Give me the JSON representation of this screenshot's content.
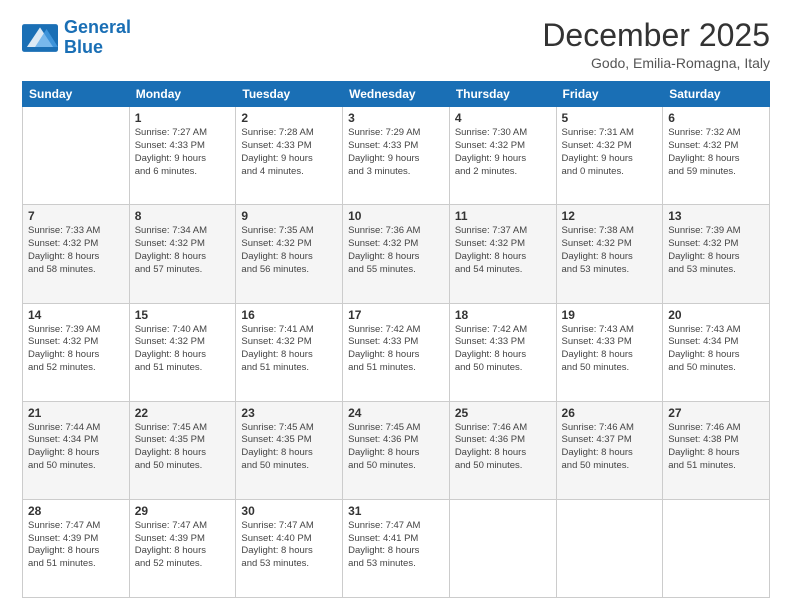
{
  "logo": {
    "line1": "General",
    "line2": "Blue"
  },
  "header": {
    "month": "December 2025",
    "location": "Godo, Emilia-Romagna, Italy"
  },
  "weekdays": [
    "Sunday",
    "Monday",
    "Tuesday",
    "Wednesday",
    "Thursday",
    "Friday",
    "Saturday"
  ],
  "weeks": [
    [
      {
        "day": "",
        "info": ""
      },
      {
        "day": "1",
        "info": "Sunrise: 7:27 AM\nSunset: 4:33 PM\nDaylight: 9 hours\nand 6 minutes."
      },
      {
        "day": "2",
        "info": "Sunrise: 7:28 AM\nSunset: 4:33 PM\nDaylight: 9 hours\nand 4 minutes."
      },
      {
        "day": "3",
        "info": "Sunrise: 7:29 AM\nSunset: 4:33 PM\nDaylight: 9 hours\nand 3 minutes."
      },
      {
        "day": "4",
        "info": "Sunrise: 7:30 AM\nSunset: 4:32 PM\nDaylight: 9 hours\nand 2 minutes."
      },
      {
        "day": "5",
        "info": "Sunrise: 7:31 AM\nSunset: 4:32 PM\nDaylight: 9 hours\nand 0 minutes."
      },
      {
        "day": "6",
        "info": "Sunrise: 7:32 AM\nSunset: 4:32 PM\nDaylight: 8 hours\nand 59 minutes."
      }
    ],
    [
      {
        "day": "7",
        "info": "Sunrise: 7:33 AM\nSunset: 4:32 PM\nDaylight: 8 hours\nand 58 minutes."
      },
      {
        "day": "8",
        "info": "Sunrise: 7:34 AM\nSunset: 4:32 PM\nDaylight: 8 hours\nand 57 minutes."
      },
      {
        "day": "9",
        "info": "Sunrise: 7:35 AM\nSunset: 4:32 PM\nDaylight: 8 hours\nand 56 minutes."
      },
      {
        "day": "10",
        "info": "Sunrise: 7:36 AM\nSunset: 4:32 PM\nDaylight: 8 hours\nand 55 minutes."
      },
      {
        "day": "11",
        "info": "Sunrise: 7:37 AM\nSunset: 4:32 PM\nDaylight: 8 hours\nand 54 minutes."
      },
      {
        "day": "12",
        "info": "Sunrise: 7:38 AM\nSunset: 4:32 PM\nDaylight: 8 hours\nand 53 minutes."
      },
      {
        "day": "13",
        "info": "Sunrise: 7:39 AM\nSunset: 4:32 PM\nDaylight: 8 hours\nand 53 minutes."
      }
    ],
    [
      {
        "day": "14",
        "info": "Sunrise: 7:39 AM\nSunset: 4:32 PM\nDaylight: 8 hours\nand 52 minutes."
      },
      {
        "day": "15",
        "info": "Sunrise: 7:40 AM\nSunset: 4:32 PM\nDaylight: 8 hours\nand 51 minutes."
      },
      {
        "day": "16",
        "info": "Sunrise: 7:41 AM\nSunset: 4:32 PM\nDaylight: 8 hours\nand 51 minutes."
      },
      {
        "day": "17",
        "info": "Sunrise: 7:42 AM\nSunset: 4:33 PM\nDaylight: 8 hours\nand 51 minutes."
      },
      {
        "day": "18",
        "info": "Sunrise: 7:42 AM\nSunset: 4:33 PM\nDaylight: 8 hours\nand 50 minutes."
      },
      {
        "day": "19",
        "info": "Sunrise: 7:43 AM\nSunset: 4:33 PM\nDaylight: 8 hours\nand 50 minutes."
      },
      {
        "day": "20",
        "info": "Sunrise: 7:43 AM\nSunset: 4:34 PM\nDaylight: 8 hours\nand 50 minutes."
      }
    ],
    [
      {
        "day": "21",
        "info": "Sunrise: 7:44 AM\nSunset: 4:34 PM\nDaylight: 8 hours\nand 50 minutes."
      },
      {
        "day": "22",
        "info": "Sunrise: 7:45 AM\nSunset: 4:35 PM\nDaylight: 8 hours\nand 50 minutes."
      },
      {
        "day": "23",
        "info": "Sunrise: 7:45 AM\nSunset: 4:35 PM\nDaylight: 8 hours\nand 50 minutes."
      },
      {
        "day": "24",
        "info": "Sunrise: 7:45 AM\nSunset: 4:36 PM\nDaylight: 8 hours\nand 50 minutes."
      },
      {
        "day": "25",
        "info": "Sunrise: 7:46 AM\nSunset: 4:36 PM\nDaylight: 8 hours\nand 50 minutes."
      },
      {
        "day": "26",
        "info": "Sunrise: 7:46 AM\nSunset: 4:37 PM\nDaylight: 8 hours\nand 50 minutes."
      },
      {
        "day": "27",
        "info": "Sunrise: 7:46 AM\nSunset: 4:38 PM\nDaylight: 8 hours\nand 51 minutes."
      }
    ],
    [
      {
        "day": "28",
        "info": "Sunrise: 7:47 AM\nSunset: 4:39 PM\nDaylight: 8 hours\nand 51 minutes."
      },
      {
        "day": "29",
        "info": "Sunrise: 7:47 AM\nSunset: 4:39 PM\nDaylight: 8 hours\nand 52 minutes."
      },
      {
        "day": "30",
        "info": "Sunrise: 7:47 AM\nSunset: 4:40 PM\nDaylight: 8 hours\nand 53 minutes."
      },
      {
        "day": "31",
        "info": "Sunrise: 7:47 AM\nSunset: 4:41 PM\nDaylight: 8 hours\nand 53 minutes."
      },
      {
        "day": "",
        "info": ""
      },
      {
        "day": "",
        "info": ""
      },
      {
        "day": "",
        "info": ""
      }
    ]
  ]
}
